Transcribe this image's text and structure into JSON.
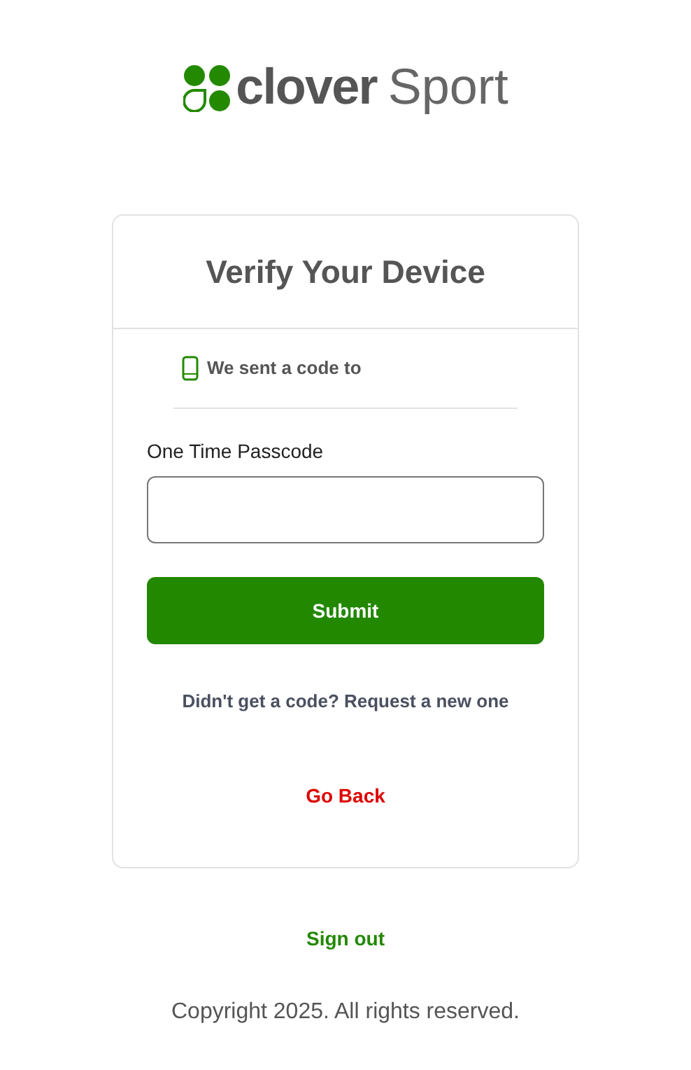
{
  "logo": {
    "brand": "clover",
    "product": "Sport"
  },
  "card": {
    "title": "Verify Your Device",
    "sent_notice": "We sent a code to",
    "field": {
      "label": "One Time Passcode"
    },
    "submit": "Submit",
    "resend": "Didn't get a code? Request a new one",
    "back": "Go Back"
  },
  "sign_out": "Sign out",
  "footer": "Copyright 2025. All rights reserved."
}
